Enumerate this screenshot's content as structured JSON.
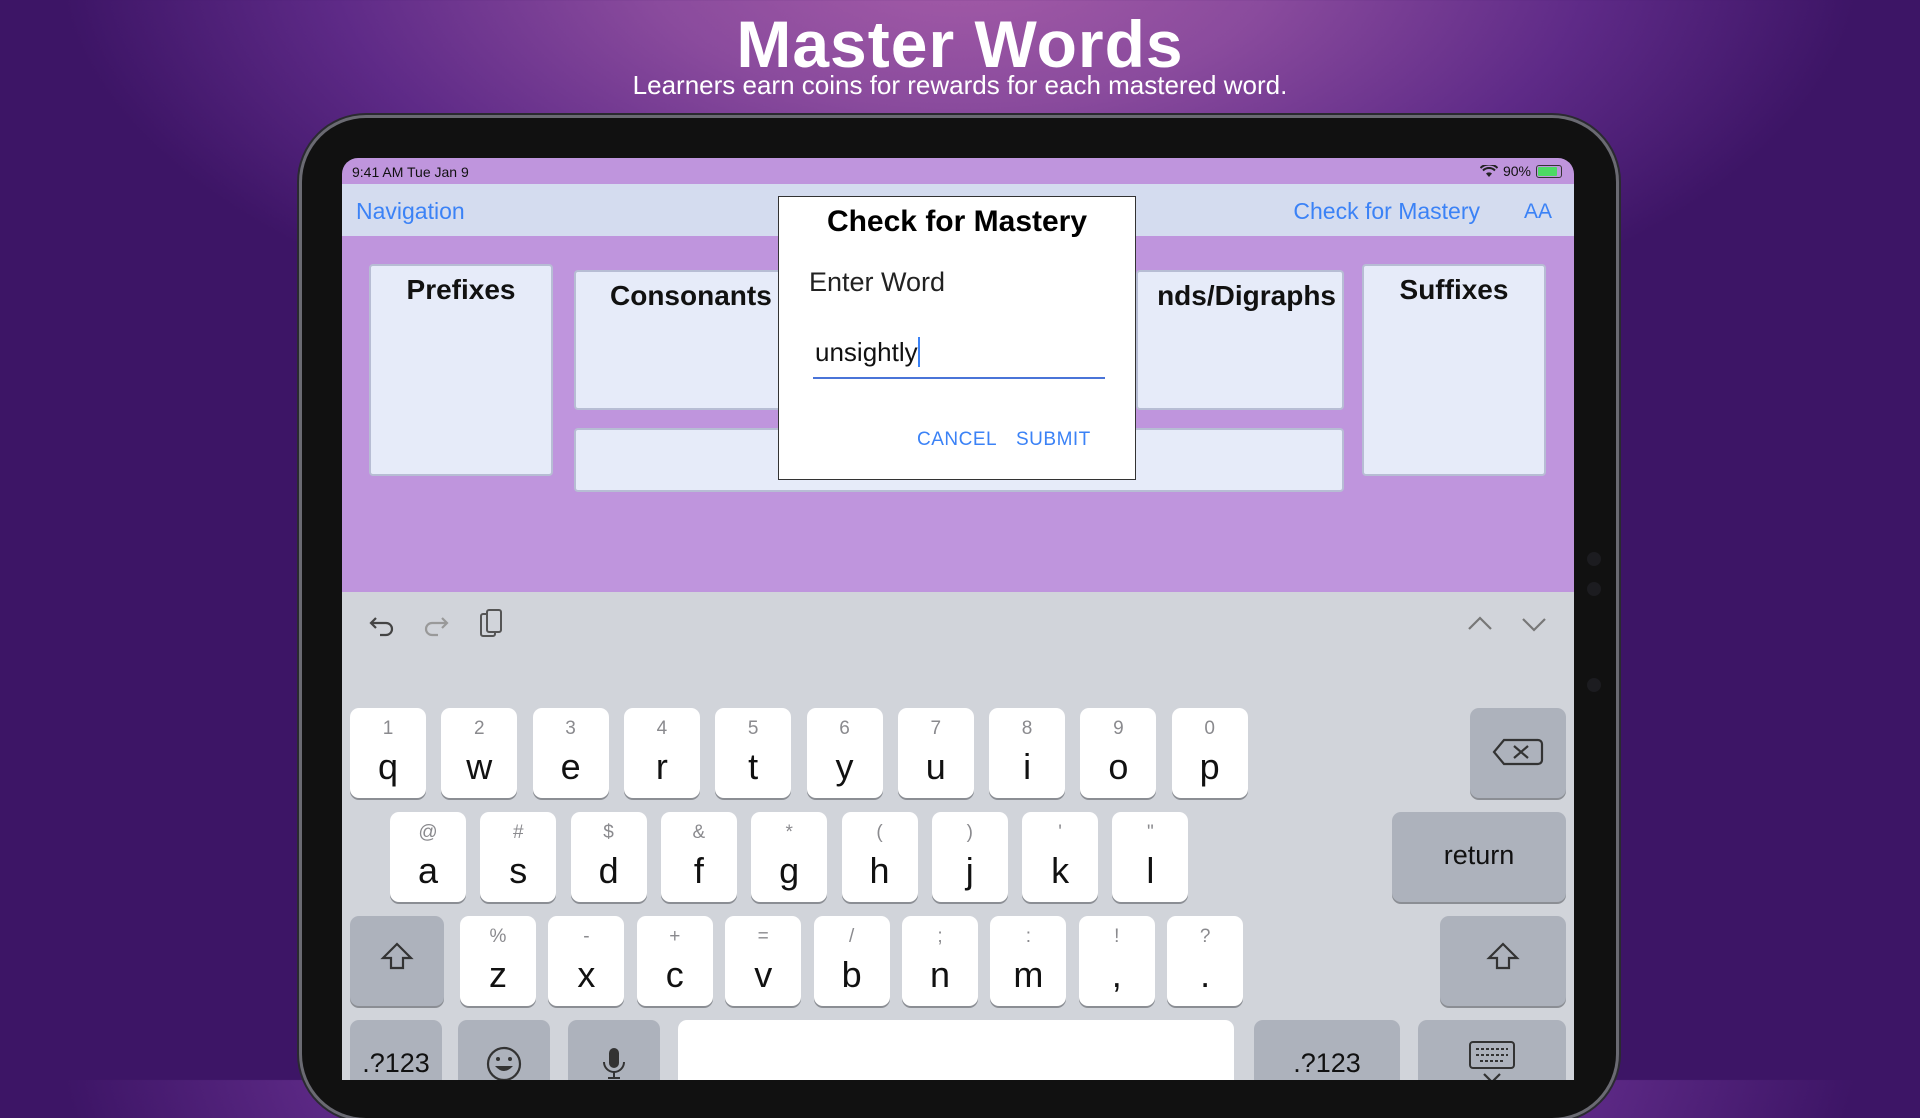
{
  "promo": {
    "title": "Master Words",
    "subtitle": "Learners earn coins for rewards for each mastered word."
  },
  "status_bar": {
    "time": "9:41 AM   Tue Jan 9",
    "battery": "90%"
  },
  "nav": {
    "left": "Navigation",
    "title": "Check for Mastery",
    "text_size": "AA"
  },
  "categories": {
    "prefixes": "Prefixes",
    "consonants": "Consonants",
    "blends": "nds/Digraphs",
    "suffixes": "Suffixes"
  },
  "dialog": {
    "title": "Check for Mastery",
    "prompt": "Enter Word",
    "input_value": "unsightly",
    "cancel": "CANCEL",
    "submit": "SUBMIT"
  },
  "keyboard": {
    "row1": [
      {
        "alt": "1",
        "key": "q"
      },
      {
        "alt": "2",
        "key": "w"
      },
      {
        "alt": "3",
        "key": "e"
      },
      {
        "alt": "4",
        "key": "r"
      },
      {
        "alt": "5",
        "key": "t"
      },
      {
        "alt": "6",
        "key": "y"
      },
      {
        "alt": "7",
        "key": "u"
      },
      {
        "alt": "8",
        "key": "i"
      },
      {
        "alt": "9",
        "key": "o"
      },
      {
        "alt": "0",
        "key": "p"
      }
    ],
    "row2": [
      {
        "alt": "@",
        "key": "a"
      },
      {
        "alt": "#",
        "key": "s"
      },
      {
        "alt": "$",
        "key": "d"
      },
      {
        "alt": "&",
        "key": "f"
      },
      {
        "alt": "*",
        "key": "g"
      },
      {
        "alt": "(",
        "key": "h"
      },
      {
        "alt": ")",
        "key": "j"
      },
      {
        "alt": "'",
        "key": "k"
      },
      {
        "alt": "\"",
        "key": "l"
      }
    ],
    "row3": [
      {
        "alt": "%",
        "key": "z"
      },
      {
        "alt": "-",
        "key": "x"
      },
      {
        "alt": "+",
        "key": "c"
      },
      {
        "alt": "=",
        "key": "v"
      },
      {
        "alt": "/",
        "key": "b"
      },
      {
        "alt": ";",
        "key": "n"
      },
      {
        "alt": ":",
        "key": "m"
      },
      {
        "alt": "!",
        "key": ","
      },
      {
        "alt": "?",
        "key": "."
      }
    ],
    "return_label": "return",
    "numbers_label": ".?123",
    "numbers_label_right": ".?123",
    "icons": {
      "delete": "delete-icon",
      "shift": "shift-icon",
      "emoji": "emoji-icon",
      "mic": "microphone-icon",
      "hide": "keyboard-hide-icon",
      "undo": "undo-icon",
      "redo": "redo-icon",
      "paste": "paste-icon"
    }
  }
}
